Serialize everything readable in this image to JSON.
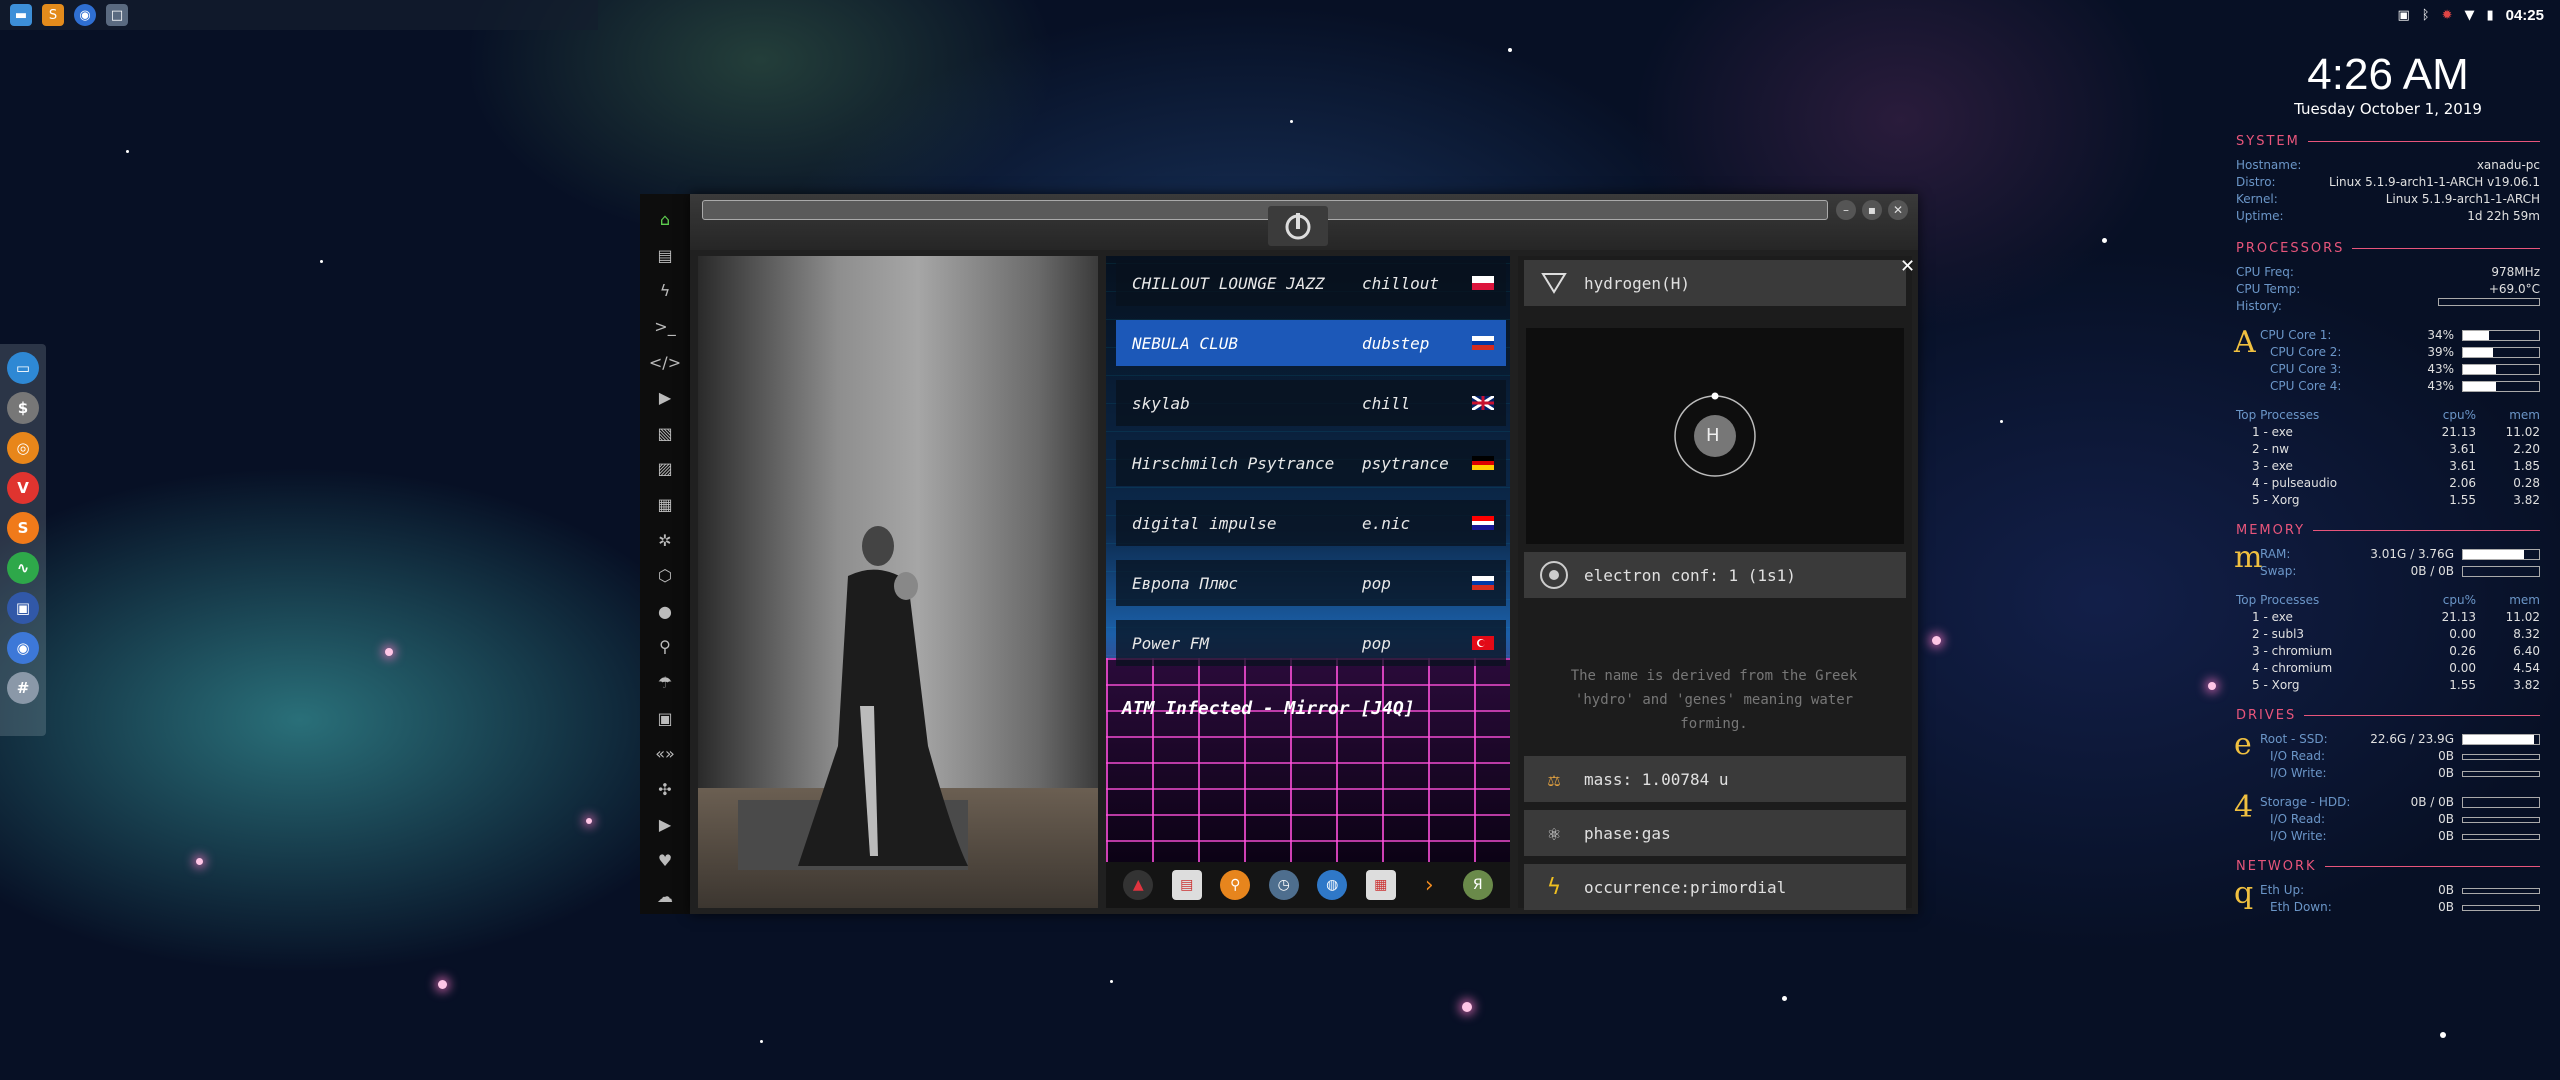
{
  "topbar": {
    "launcher_icons": [
      "files-icon",
      "sublime-icon",
      "chrome-icon",
      "window-icon"
    ],
    "tray_icons": [
      "screenshot-icon",
      "bluetooth-icon",
      "gear-icon",
      "wifi-icon",
      "battery-icon"
    ],
    "clock": "04:25"
  },
  "dock": {
    "icons": [
      "files-icon",
      "money-icon",
      "ubuntu-icon",
      "vivaldi-icon",
      "sublime-icon",
      "activity-icon",
      "screen-icon",
      "chrome-icon",
      "grid-icon"
    ]
  },
  "sidebar": {
    "icons": [
      "home-icon",
      "document-icon",
      "bolt-icon",
      "terminal-icon",
      "code-icon",
      "play-icon",
      "image-stack-icon",
      "image-icon",
      "news-icon",
      "gear-icon",
      "hexagon-icon",
      "globe-icon",
      "search-icon",
      "umbrella-icon",
      "contact-icon",
      "code-brackets-icon",
      "expand-icon",
      "youtube-icon",
      "heart-icon",
      "cloud-icon"
    ]
  },
  "radio": {
    "stations": [
      {
        "name": "CHILLOUT LOUNGE JAZZ",
        "genre": "chillout",
        "flag": "poland"
      },
      {
        "name": "NEBULA CLUB",
        "genre": "dubstep",
        "flag": "russia"
      },
      {
        "name": "skylab",
        "genre": "chill",
        "flag": "uk"
      },
      {
        "name": "Hirschmilch Psytrance",
        "genre": "psytrance",
        "flag": "germany"
      },
      {
        "name": "digital impulse",
        "genre": "e.nic",
        "flag": "croatia"
      },
      {
        "name": "Европа Плюс",
        "genre": "pop",
        "flag": "russia"
      },
      {
        "name": "Power FM",
        "genre": "pop",
        "flag": "turkey"
      }
    ],
    "now_playing": "ATM Infected - Mirror [J4Q]",
    "appbar_icons": [
      "warning-icon",
      "calendar-app-icon",
      "search-app-icon",
      "clock-app-icon",
      "globe-app-icon",
      "calendar-icon",
      "arrow-icon",
      "yandex-icon"
    ]
  },
  "element": {
    "name": "hydrogen(H)",
    "symbol": "H",
    "electron_conf": "electron conf: 1 (1s1)",
    "description": "The name is derived from the Greek 'hydro' and 'genes' meaning water forming.",
    "mass": "mass: 1.00784 u",
    "phase": "phase:gas",
    "occurrence": "occurrence:primordial"
  },
  "conky": {
    "time": "4:26 AM",
    "date": "Tuesday October  1, 2019",
    "system": {
      "title": "SYSTEM",
      "rows": [
        {
          "k": "Hostname:",
          "v": "xanadu-pc"
        },
        {
          "k": "Distro:",
          "v": "Linux 5.1.9-arch1-1-ARCH v19.06.1"
        },
        {
          "k": "Kernel:",
          "v": "Linux 5.1.9-arch1-1-ARCH"
        },
        {
          "k": "Uptime:",
          "v": "1d 22h 59m"
        }
      ]
    },
    "processors": {
      "title": "PROCESSORS",
      "freq": {
        "k": "CPU Freq:",
        "v": "978MHz"
      },
      "temp": {
        "k": "CPU Temp:",
        "v": "+69.0°C"
      },
      "history": {
        "k": "History:"
      },
      "glyph": "A",
      "cores": [
        {
          "k": "CPU Core 1:",
          "v": "34%",
          "pct": 34
        },
        {
          "k": "CPU Core 2:",
          "v": "39%",
          "pct": 39
        },
        {
          "k": "CPU Core 3:",
          "v": "43%",
          "pct": 43
        },
        {
          "k": "CPU Core 4:",
          "v": "43%",
          "pct": 43
        }
      ],
      "top_header": {
        "n": "Top Processes",
        "c": "cpu%",
        "m": "mem"
      },
      "top": [
        {
          "n": "1 - exe",
          "c": "21.13",
          "m": "11.02"
        },
        {
          "n": "2 - nw",
          "c": "3.61",
          "m": "2.20"
        },
        {
          "n": "3 - exe",
          "c": "3.61",
          "m": "1.85"
        },
        {
          "n": "4 - pulseaudio",
          "c": "2.06",
          "m": "0.28"
        },
        {
          "n": "5 - Xorg",
          "c": "1.55",
          "m": "3.82"
        }
      ]
    },
    "memory": {
      "title": "MEMORY",
      "glyph": "m",
      "ram": {
        "k": "RAM:",
        "v": "3.01G / 3.76G",
        "pct": 80
      },
      "swap": {
        "k": "Swap:",
        "v": "0B / 0B",
        "pct": 0
      },
      "top_header": {
        "n": "Top Processes",
        "c": "cpu%",
        "m": "mem"
      },
      "top": [
        {
          "n": "1 - exe",
          "c": "21.13",
          "m": "11.02"
        },
        {
          "n": "2 - subl3",
          "c": "0.00",
          "m": "8.32"
        },
        {
          "n": "3 - chromium",
          "c": "0.26",
          "m": "6.40"
        },
        {
          "n": "4 - chromium",
          "c": "0.00",
          "m": "4.54"
        },
        {
          "n": "5 - Xorg",
          "c": "1.55",
          "m": "3.82"
        }
      ]
    },
    "drives": {
      "title": "DRIVES",
      "root": {
        "glyph": "e",
        "k": "Root - SSD:",
        "v": "22.6G / 23.9G",
        "pct": 94,
        "read": {
          "k": "I/O Read:",
          "v": "0B"
        },
        "write": {
          "k": "I/O Write:",
          "v": "0B"
        }
      },
      "storage": {
        "glyph": "4",
        "k": "Storage - HDD:",
        "v": "0B / 0B",
        "pct": 0,
        "read": {
          "k": "I/O Read:",
          "v": "0B"
        },
        "write": {
          "k": "I/O Write:",
          "v": "0B"
        }
      }
    },
    "network": {
      "title": "NETWORK",
      "glyph": "q",
      "up": {
        "k": "Eth Up:",
        "v": "0B"
      },
      "down": {
        "k": "Eth Down:",
        "v": "0B"
      }
    }
  }
}
